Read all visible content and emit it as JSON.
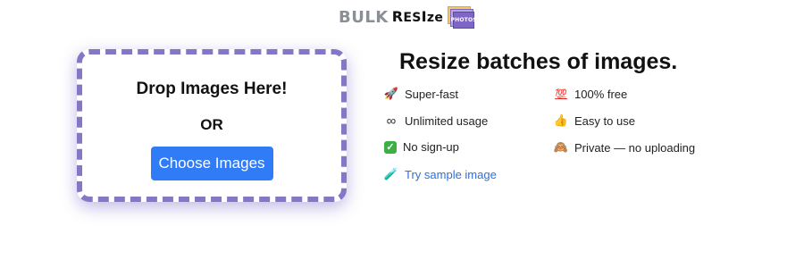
{
  "logo": {
    "bulk": "BULK",
    "resize_r": "R",
    "resize_rest": "ES",
    "resize_i": "I",
    "resize_ze": "ze",
    "photos": "PHOTOS"
  },
  "dropzone": {
    "title": "Drop Images Here!",
    "or": "OR",
    "button_label": "Choose Images",
    "border_color": "#8677c6"
  },
  "headline": "Resize batches of images.",
  "features": {
    "col1": [
      {
        "icon": "rocket-icon",
        "label": "Super-fast"
      },
      {
        "icon": "infinity-icon",
        "label": "Unlimited usage"
      },
      {
        "icon": "check-mark-icon",
        "label": "No sign-up"
      }
    ],
    "col2": [
      {
        "icon": "hundred-points-icon",
        "label": "100% free"
      },
      {
        "icon": "thumbs-up-icon",
        "label": "Easy to use"
      },
      {
        "icon": "see-no-evil-monkey-icon",
        "label": "Private — no uploading"
      }
    ],
    "sample": {
      "icon": "test-tube-icon",
      "label": "Try sample image"
    }
  },
  "colors": {
    "accent_button": "#2f7cf6",
    "link": "#2f6fd6",
    "dropzone_border": "#8677c6"
  }
}
